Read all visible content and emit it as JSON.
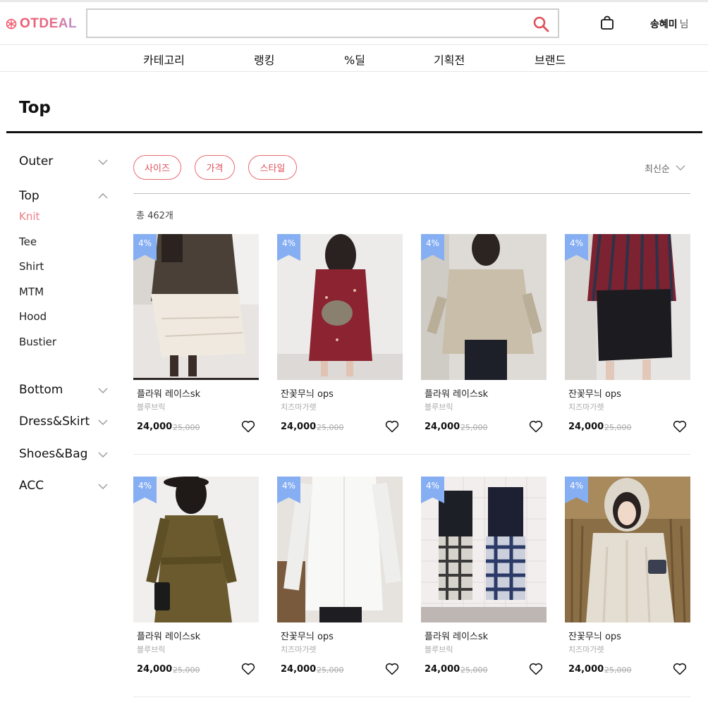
{
  "header": {
    "logo_text": "OTDEAL",
    "search": {
      "value": "",
      "placeholder": ""
    },
    "user": {
      "name": "송혜미",
      "suffix": "님"
    }
  },
  "nav": {
    "items": [
      "카테고리",
      "랭킹",
      "%딜",
      "기획전",
      "브랜드"
    ]
  },
  "page": {
    "title": "Top"
  },
  "sidebar": {
    "categories": [
      {
        "label": "Outer",
        "expanded": false
      },
      {
        "label": "Top",
        "expanded": true,
        "children": [
          "Knit",
          "Tee",
          "Shirt",
          "MTM",
          "Hood",
          "Bustier"
        ],
        "active_child": "Knit"
      },
      {
        "label": "Bottom",
        "expanded": false
      },
      {
        "label": "Dress&Skirt",
        "expanded": false
      },
      {
        "label": "Shoes&Bag",
        "expanded": false
      },
      {
        "label": "ACC",
        "expanded": false
      }
    ]
  },
  "filters": {
    "chips": [
      "사이즈",
      "가격",
      "스타일"
    ],
    "sort_label": "최신순"
  },
  "listing": {
    "total_label": "총 462개"
  },
  "products": [
    {
      "badge": "4%",
      "name": "플라워 레이스sk",
      "brand": "블루브릭",
      "price": "24,000",
      "original_price": "25,000",
      "image": "lace-skirt-photo"
    },
    {
      "badge": "4%",
      "name": "잔꽃무늬 ops",
      "brand": "치즈마가렛",
      "price": "24,000",
      "original_price": "25,000",
      "image": "floral-dress-photo"
    },
    {
      "badge": "4%",
      "name": "플라워 레이스sk",
      "brand": "블루브릭",
      "price": "24,000",
      "original_price": "25,000",
      "image": "beige-top-photo"
    },
    {
      "badge": "4%",
      "name": "잔꽃무늬 ops",
      "brand": "치즈마가렛",
      "price": "24,000",
      "original_price": "25,000",
      "image": "striped-shirt-photo"
    },
    {
      "badge": "4%",
      "name": "플라워 레이스sk",
      "brand": "블루브릭",
      "price": "24,000",
      "original_price": "25,000",
      "image": "khaki-dress-photo"
    },
    {
      "badge": "4%",
      "name": "잔꽃무늬 ops",
      "brand": "치즈마가렛",
      "price": "24,000",
      "original_price": "25,000",
      "image": "white-shirt-photo"
    },
    {
      "badge": "4%",
      "name": "플라워 레이스sk",
      "brand": "블루브릭",
      "price": "24,000",
      "original_price": "25,000",
      "image": "plaid-couple-photo"
    },
    {
      "badge": "4%",
      "name": "잔꽃무늬 ops",
      "brand": "치즈마가렛",
      "price": "24,000",
      "original_price": "25,000",
      "image": "knit-cardigan-photo"
    }
  ],
  "colors": {
    "brand": "#f0566b",
    "accent_pink": "#e0505b",
    "badge_blue": "#86aef3",
    "active_sub": "#f07b84"
  }
}
